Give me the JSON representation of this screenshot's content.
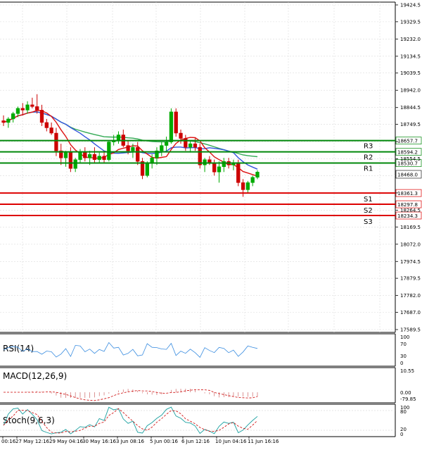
{
  "chart_data": {
    "type": "candlestick",
    "price_axis": {
      "ticks": [
        19424.5,
        19329.5,
        19232.0,
        19134.5,
        19039.5,
        18942.0,
        18844.5,
        18749.5,
        18652.0,
        18554.5,
        18459.5,
        18362.0,
        18264.5,
        18169.5,
        18072.0,
        17974.5,
        17879.5,
        17782.0,
        17687.0,
        17589.5
      ],
      "range": [
        17575,
        19440
      ]
    },
    "time_axis": {
      "labels": [
        "00:16",
        "27 May 12:16",
        "29 May 04:16",
        "30 May 16:16",
        "3 Jun 08:16",
        "5 Jun 00:16",
        "6 Jun 12:16",
        "10 Jun 04:16",
        "11 Jun 16:16"
      ]
    },
    "current_price": {
      "label": "18468.0",
      "value": 18468.0
    },
    "resistance": [
      {
        "name": "R1",
        "label": "18530.7",
        "value": 18530.7
      },
      {
        "name": "R2",
        "label": "18594.2",
        "value": 18594.2
      },
      {
        "name": "R3",
        "label": "18657.7",
        "value": 18657.7
      }
    ],
    "support": [
      {
        "name": "S1",
        "label": "18361.3",
        "value": 18361.3
      },
      {
        "name": "S2",
        "label": "18297.8",
        "value": 18297.8
      },
      {
        "name": "S3",
        "label": "18234.3",
        "value": 18234.3
      }
    ],
    "candles": [
      [
        18770,
        18800,
        18740,
        18760
      ],
      [
        18760,
        18790,
        18730,
        18780
      ],
      [
        18780,
        18820,
        18760,
        18810
      ],
      [
        18810,
        18850,
        18790,
        18840
      ],
      [
        18840,
        18870,
        18800,
        18830
      ],
      [
        18830,
        18880,
        18810,
        18860
      ],
      [
        18860,
        18900,
        18840,
        18850
      ],
      [
        18850,
        18920,
        18810,
        18830
      ],
      [
        18830,
        18860,
        18740,
        18760
      ],
      [
        18760,
        18780,
        18710,
        18730
      ],
      [
        18730,
        18760,
        18690,
        18700
      ],
      [
        18700,
        18730,
        18570,
        18600
      ],
      [
        18600,
        18640,
        18520,
        18560
      ],
      [
        18560,
        18600,
        18510,
        18590
      ],
      [
        18590,
        18620,
        18480,
        18500
      ],
      [
        18500,
        18560,
        18480,
        18550
      ],
      [
        18550,
        18610,
        18530,
        18590
      ],
      [
        18590,
        18620,
        18540,
        18560
      ],
      [
        18560,
        18600,
        18520,
        18580
      ],
      [
        18580,
        18620,
        18530,
        18550
      ],
      [
        18550,
        18590,
        18530,
        18570
      ],
      [
        18570,
        18600,
        18530,
        18550
      ],
      [
        18550,
        18660,
        18540,
        18650
      ],
      [
        18650,
        18690,
        18630,
        18660
      ],
      [
        18660,
        18710,
        18640,
        18690
      ],
      [
        18690,
        18720,
        18620,
        18630
      ],
      [
        18630,
        18660,
        18580,
        18600
      ],
      [
        18600,
        18640,
        18560,
        18620
      ],
      [
        18620,
        18650,
        18520,
        18540
      ],
      [
        18540,
        18560,
        18440,
        18460
      ],
      [
        18460,
        18540,
        18450,
        18530
      ],
      [
        18530,
        18580,
        18500,
        18560
      ],
      [
        18560,
        18620,
        18520,
        18600
      ],
      [
        18600,
        18650,
        18570,
        18630
      ],
      [
        18630,
        18680,
        18600,
        18650
      ],
      [
        18650,
        18840,
        18640,
        18820
      ],
      [
        18820,
        18840,
        18680,
        18700
      ],
      [
        18700,
        18720,
        18640,
        18670
      ],
      [
        18670,
        18690,
        18600,
        18620
      ],
      [
        18620,
        18660,
        18590,
        18640
      ],
      [
        18640,
        18670,
        18600,
        18620
      ],
      [
        18620,
        18640,
        18500,
        18520
      ],
      [
        18520,
        18560,
        18480,
        18550
      ],
      [
        18550,
        18570,
        18520,
        18530
      ],
      [
        18530,
        18550,
        18460,
        18480
      ],
      [
        18480,
        18540,
        18420,
        18510
      ],
      [
        18510,
        18560,
        18480,
        18540
      ],
      [
        18540,
        18560,
        18500,
        18520
      ],
      [
        18520,
        18550,
        18490,
        18530
      ],
      [
        18530,
        18550,
        18400,
        18420
      ],
      [
        18420,
        18440,
        18340,
        18380
      ],
      [
        18380,
        18430,
        18360,
        18420
      ],
      [
        18420,
        18460,
        18400,
        18450
      ],
      [
        18450,
        18490,
        18440,
        18480
      ]
    ],
    "indicators": [
      {
        "name": "RSI(14)",
        "levels": [
          "100",
          "70",
          "30",
          "0"
        ]
      },
      {
        "name": "MACD(12,26,9)",
        "levels": [
          "10.55",
          "0.00",
          "-79.85"
        ]
      },
      {
        "name": "Stoch(9,6,3)",
        "levels": [
          "100",
          "80",
          "20",
          "0"
        ]
      }
    ]
  },
  "colors": {
    "bull": "#00aa00",
    "bear": "#cc0000",
    "ma_fast": "#dd1111",
    "ma_mid": "#3355dd",
    "ma_slow": "#33aa55",
    "resistance": "#00880a",
    "support": "#dd0000",
    "grid": "#dcdcdc"
  }
}
